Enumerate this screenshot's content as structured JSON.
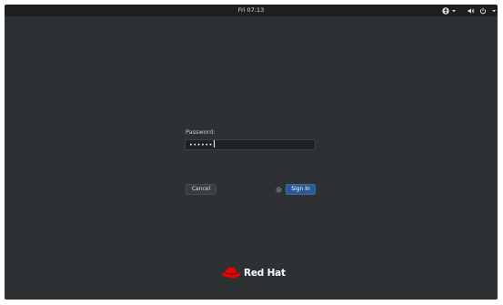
{
  "topbar": {
    "clock": "Fri 07:13",
    "icons": [
      "accessibility-icon",
      "chevron-down-icon",
      "volume-icon",
      "power-icon",
      "chevron-down-icon"
    ]
  },
  "login": {
    "password_label": "Password:",
    "password_value": "••••••",
    "cancel_label": "Cancel",
    "signin_label": "Sign In"
  },
  "branding": {
    "logo_text": "Red Hat"
  },
  "colors": {
    "background": "#2e3133",
    "topbar": "#1d1f20",
    "signin_accent": "#2b5a92",
    "redhat_red": "#ee0000"
  }
}
